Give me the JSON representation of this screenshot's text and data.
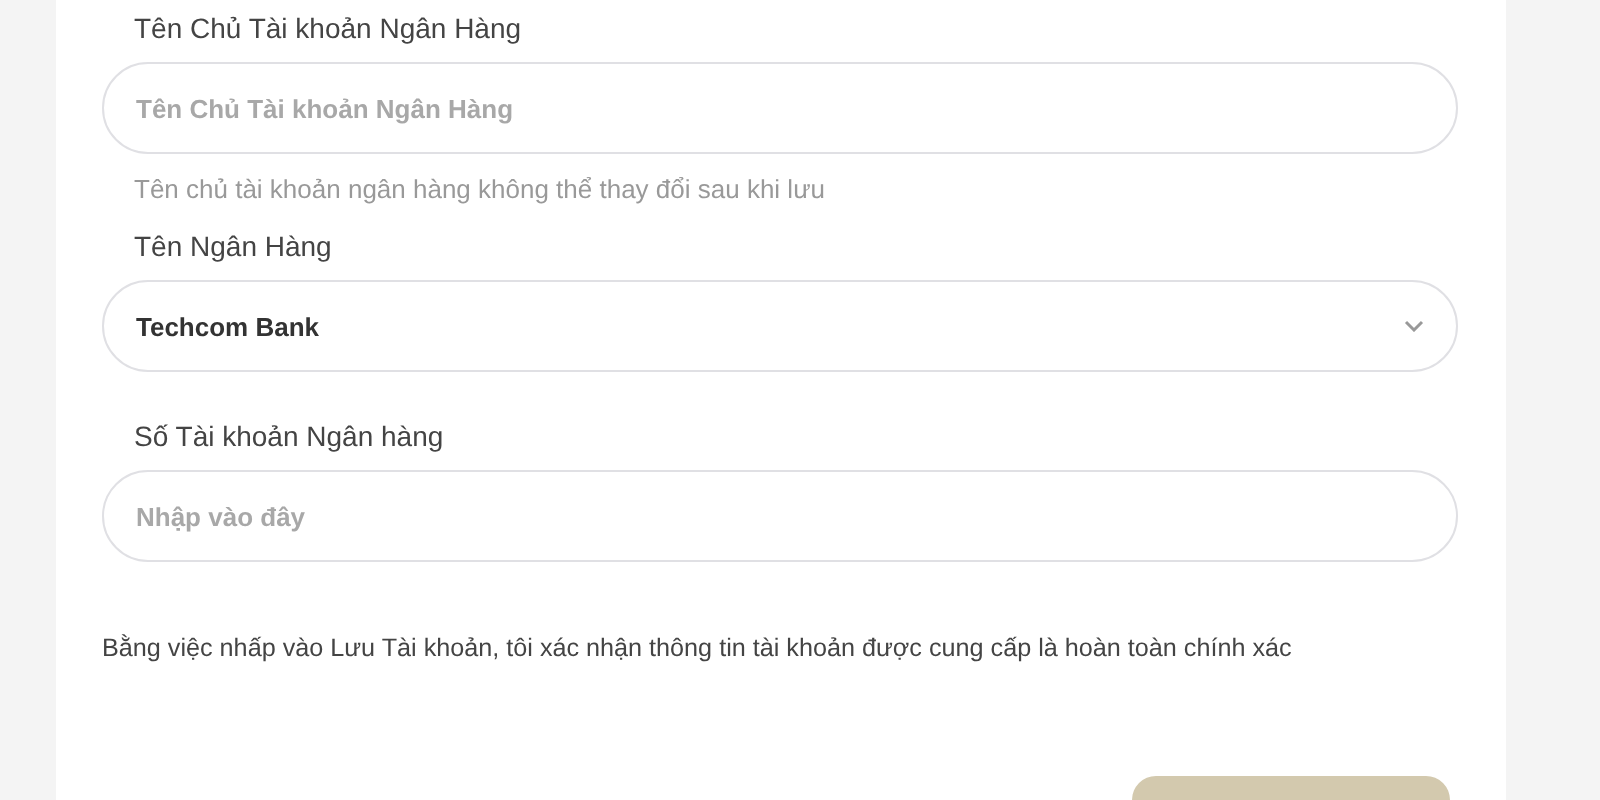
{
  "fields": [
    {
      "kind": "input",
      "label": "Tên Chủ Tài khoản Ngân Hàng",
      "placeholder": "Tên Chủ Tài khoản Ngân Hàng",
      "help": "Tên chủ tài khoản ngân hàng không thể thay đổi sau khi lưu"
    },
    {
      "kind": "select",
      "label": "Tên Ngân Hàng",
      "value": "Techcom Bank"
    },
    {
      "kind": "input",
      "label": "Số Tài khoản Ngân hàng",
      "placeholder": "Nhập vào đây"
    }
  ],
  "disclaimer": "Bằng việc nhấp vào Lưu Tài khoản, tôi xác nhận thông tin tài khoản được cung cấp là hoàn toàn chính xác",
  "button": {
    "kind": "partial"
  }
}
